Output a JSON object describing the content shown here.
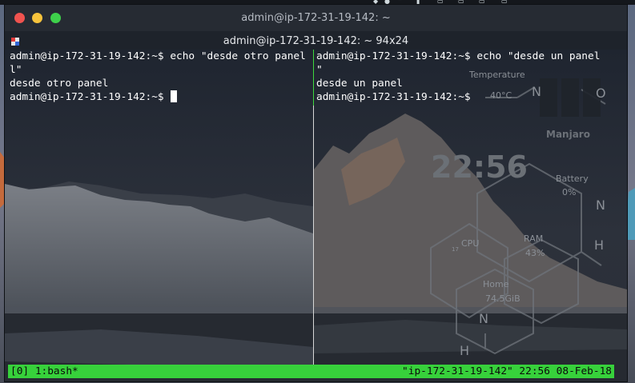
{
  "window": {
    "title": "admin@ip-172-31-19-142: ~"
  },
  "tab": {
    "title": "admin@ip-172-31-19-142: ~ 94x24"
  },
  "panes": {
    "left": {
      "lines": [
        "admin@ip-172-31-19-142:~$ echo \"desde otro panel",
        "l\"",
        "desde otro panel",
        "admin@ip-172-31-19-142:~$ "
      ]
    },
    "right": {
      "lines": [
        "admin@ip-172-31-19-142:~$ echo \"desde un panel",
        "\"",
        "desde un panel",
        "admin@ip-172-31-19-142:~$ "
      ]
    }
  },
  "statusbar": {
    "left": "[0] 1:bash*",
    "right": "\"ip-172-31-19-142\" 22:56 08-Feb-18"
  },
  "conky": {
    "temperature_label": "Temperature",
    "temperature_value": "40°C",
    "distro": "Manjaro",
    "clock": "22:56",
    "battery_label": "Battery",
    "battery_value": "0%",
    "cpu_label": "CPU",
    "cpu_value": "17",
    "ram_label": "RAM",
    "ram_value": "43%",
    "home_label": "Home",
    "home_value": "74.5GiB",
    "letter_n": "N",
    "letter_o": "O",
    "letter_h": "H"
  },
  "colors": {
    "status_green": "#37d13b",
    "close": "#f0534f",
    "minimize": "#f7c33c",
    "maximize": "#3ed14b"
  }
}
